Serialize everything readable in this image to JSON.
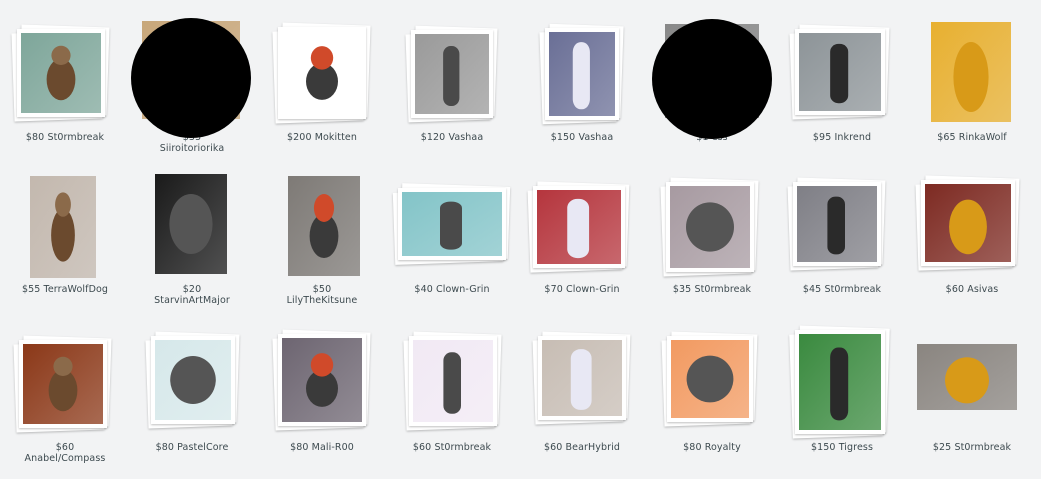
{
  "gallery": {
    "items": [
      {
        "price": "$80",
        "artist": "St0rmbreak",
        "icon": "creature-thumbnail",
        "color": "#7ea69a"
      },
      {
        "price": "$35",
        "artist": "Siiroitoriorika",
        "icon": "creature-thumbnail",
        "color": "#c8a77a"
      },
      {
        "price": "$200",
        "artist": "Mokitten",
        "icon": "creature-thumbnail",
        "color": "#ffffff"
      },
      {
        "price": "$120",
        "artist": "Vashaa",
        "icon": "creature-thumbnail",
        "color": "#9a9a9a"
      },
      {
        "price": "$150",
        "artist": "Vashaa",
        "icon": "creature-thumbnail",
        "color": "#6a6f96"
      },
      {
        "price": "$1",
        "artist": "ess",
        "icon": "creature-thumbnail",
        "color": "#888888"
      },
      {
        "price": "$95",
        "artist": "Inkrend",
        "icon": "creature-thumbnail",
        "color": "#8d9498"
      },
      {
        "price": "$65",
        "artist": "RinkaWolf",
        "icon": "creature-thumbnail",
        "color": "#e8b030"
      },
      {
        "price": "$55",
        "artist": "TerraWolfDog",
        "icon": "creature-thumbnail",
        "color": "#c3b8ae"
      },
      {
        "price": "$20",
        "artist": "StarvinArtMajor",
        "icon": "creature-thumbnail",
        "color": "#1a1a1a"
      },
      {
        "price": "$50",
        "artist": "LilyTheKitsune",
        "icon": "creature-thumbnail",
        "color": "#7e7a76"
      },
      {
        "price": "$40",
        "artist": "Clown-Grin",
        "icon": "creature-thumbnail",
        "color": "#83c4c8"
      },
      {
        "price": "$70",
        "artist": "Clown-Grin",
        "icon": "creature-thumbnail",
        "color": "#b5353d"
      },
      {
        "price": "$35",
        "artist": "St0rmbreak",
        "icon": "creature-thumbnail",
        "color": "#a79aa1"
      },
      {
        "price": "$45",
        "artist": "St0rmbreak",
        "icon": "creature-thumbnail",
        "color": "#7f7f86"
      },
      {
        "price": "$60",
        "artist": "Asivas",
        "icon": "creature-thumbnail",
        "color": "#7d2a22"
      },
      {
        "price": "$60",
        "artist": "Anabel/Compass",
        "icon": "creature-thumbnail",
        "color": "#8b3818"
      },
      {
        "price": "$80",
        "artist": "PastelCore",
        "icon": "creature-thumbnail",
        "color": "#d6e8ea"
      },
      {
        "price": "$80",
        "artist": "Mali-R00",
        "icon": "creature-thumbnail",
        "color": "#6d6571"
      },
      {
        "price": "$60",
        "artist": "St0rmbreak",
        "icon": "creature-thumbnail",
        "color": "#f1e9f4"
      },
      {
        "price": "$60",
        "artist": "BearHybrid",
        "icon": "creature-thumbnail",
        "color": "#c7bdb4"
      },
      {
        "price": "$80",
        "artist": "Royalty",
        "icon": "creature-thumbnail",
        "color": "#f29a61"
      },
      {
        "price": "$150",
        "artist": "Tigress",
        "icon": "creature-thumbnail",
        "color": "#3a8a3f"
      },
      {
        "price": "$25",
        "artist": "St0rmbreak",
        "icon": "creature-thumbnail",
        "color": "#8a8580"
      }
    ]
  }
}
